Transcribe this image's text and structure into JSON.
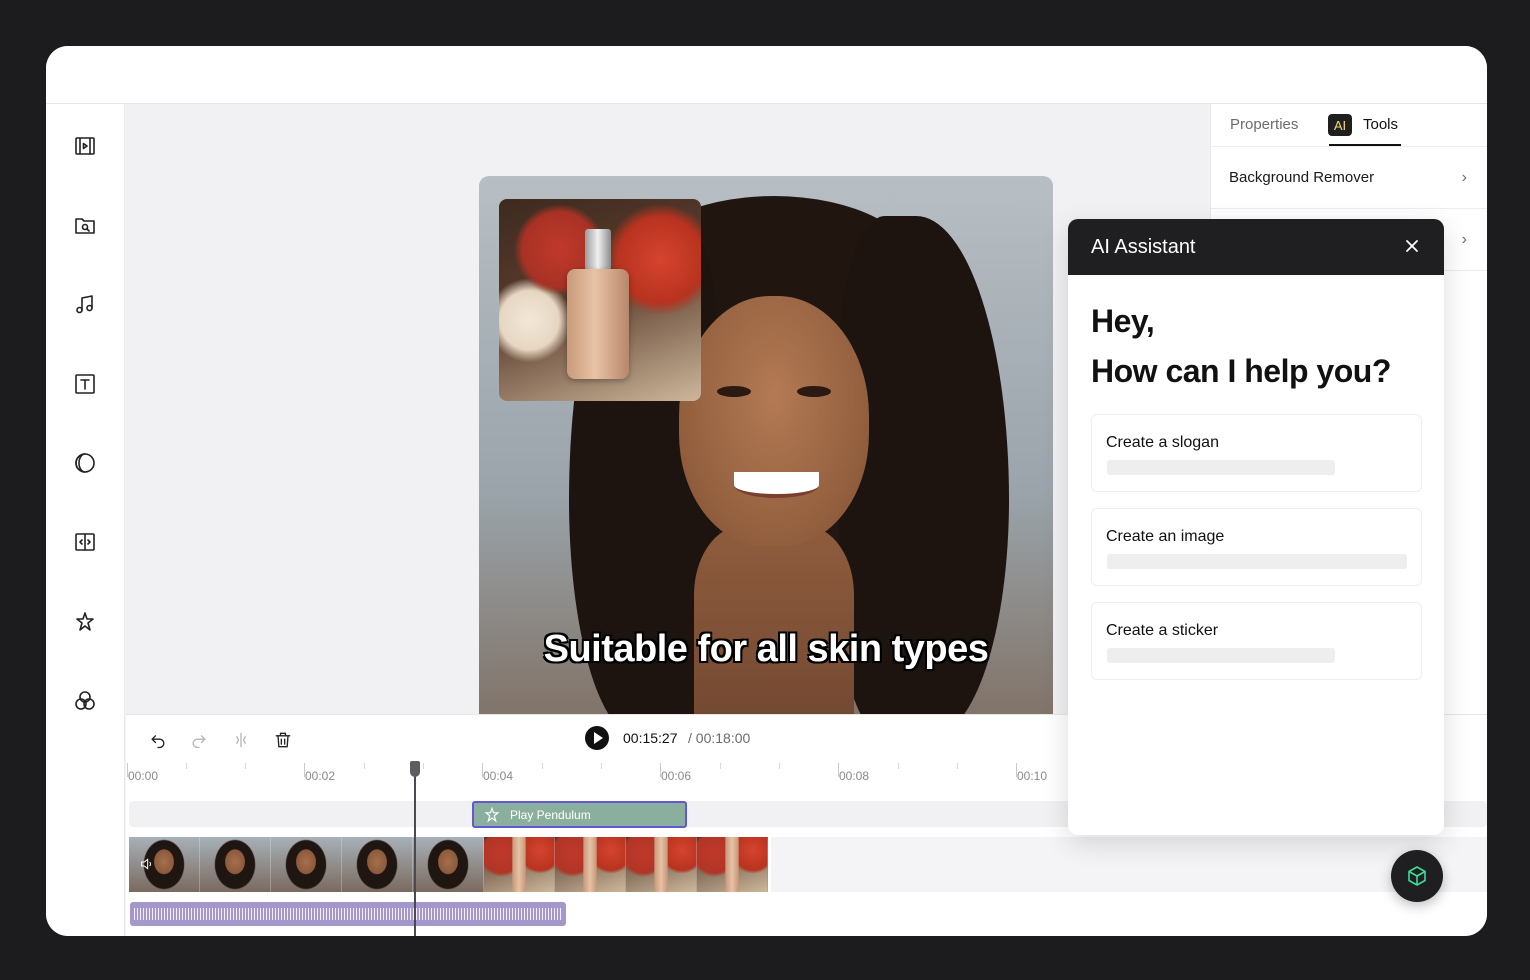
{
  "left_sidebar": {
    "items": [
      {
        "icon": "media-icon"
      },
      {
        "icon": "search-folder-icon"
      },
      {
        "icon": "music-icon"
      },
      {
        "icon": "text-icon"
      },
      {
        "icon": "filter-icon"
      },
      {
        "icon": "transition-icon"
      },
      {
        "icon": "effects-icon"
      },
      {
        "icon": "color-circles-icon"
      }
    ]
  },
  "preview": {
    "caption": "Suitable for all skin types"
  },
  "right_panel": {
    "tabs": {
      "properties": "Properties",
      "ai_badge": "AI",
      "tools": "Tools"
    },
    "rows": [
      {
        "label": "Background Remover"
      }
    ]
  },
  "timeline": {
    "current_time": "00:15:27",
    "total_time": "/ 00:18:00",
    "ruler_labels": [
      "00:00",
      "00:02",
      "00:04",
      "00:06",
      "00:08",
      "00:10"
    ],
    "effect_clip_label": "Play Pendulum"
  },
  "ai_assistant": {
    "title": "AI Assistant",
    "greeting_line1": "Hey,",
    "greeting_line2": "How can I help you?",
    "options": [
      {
        "label": "Create a slogan"
      },
      {
        "label": "Create an image"
      },
      {
        "label": "Create a sticker"
      }
    ]
  },
  "colors": {
    "frame": "#1c1c1e",
    "dialog_header": "#1f1f21",
    "effect_clip": "#8aaf9f",
    "effect_clip_border": "#6258d6",
    "audio_track": "#a497cc",
    "fab_icon": "#3ddc97",
    "ai_badge_text": "#f7d774"
  }
}
